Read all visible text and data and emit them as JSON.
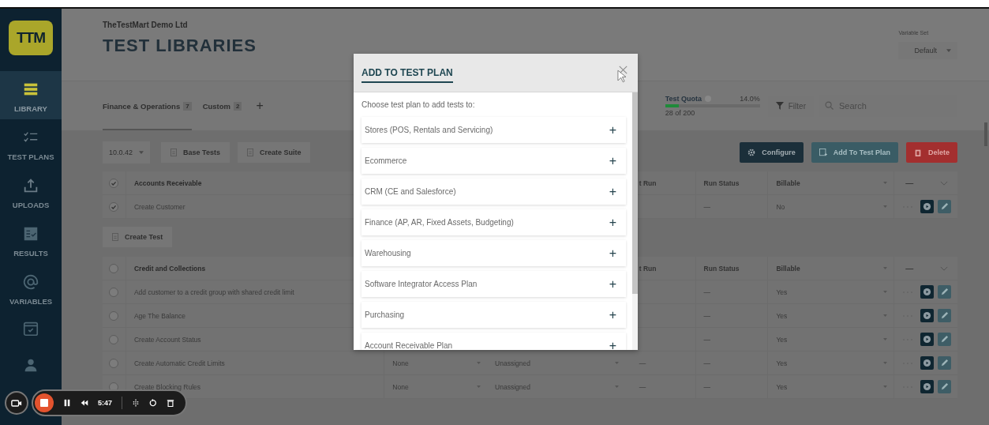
{
  "sidebar": {
    "logo": "TTM",
    "items": [
      {
        "label": "LIBRARY",
        "kind": "list",
        "selected": true
      },
      {
        "label": "TEST PLANS",
        "kind": "checklist",
        "selected": false
      },
      {
        "label": "UPLOADS",
        "kind": "upload",
        "selected": false
      },
      {
        "label": "RESULTS",
        "kind": "results",
        "selected": false
      },
      {
        "label": "VARIABLES",
        "kind": "at",
        "selected": false
      },
      {
        "kind": "calendar",
        "selected": false
      },
      {
        "kind": "person",
        "selected": false
      }
    ]
  },
  "header": {
    "company": "TheTestMart Demo Ltd",
    "title": "TEST LIBRARIES",
    "variable_set": {
      "label": "Variable Set",
      "value": "Default"
    }
  },
  "tabs": [
    {
      "label": "Finance & Operations",
      "count": "7",
      "selected": true
    },
    {
      "label": "Custom",
      "count": "2",
      "selected": false
    }
  ],
  "add_tab": "+",
  "quota": {
    "label": "Test Quota",
    "percent": "14.0%",
    "level": 0.14,
    "reading": "28 of 200"
  },
  "filter": "Filter",
  "search": {
    "placeholder": "Search"
  },
  "toolbar": {
    "version": "10.0.42",
    "left_buttons": [
      "Base Tests",
      "Create Suite"
    ],
    "right_buttons": [
      {
        "label": "Configure",
        "kind": "configure"
      },
      {
        "label": "Add To Test Plan",
        "kind": "add"
      },
      {
        "label": "Delete",
        "kind": "delete"
      }
    ]
  },
  "groups": [
    {
      "title": "Accounts Receivable",
      "checked": true,
      "headers": {
        "last_run": "t Run",
        "run_status": "Run Status",
        "billable": "Billable",
        "actions": "—"
      },
      "rows": [
        {
          "name": "Create Customer",
          "checked": true,
          "run_status": "—",
          "billable": "No"
        }
      ],
      "create_test": "Create Test"
    },
    {
      "title": "Credit and Collections",
      "checked": false,
      "headers": {
        "last_run": "t Run",
        "run_status": "Run Status",
        "billable": "Billable",
        "actions": "—"
      },
      "rows": [
        {
          "name": "Add customer to a credit group with shared credit limit",
          "checked": false,
          "run_status": "—",
          "billable": "Yes"
        },
        {
          "name": "Age The Balance",
          "checked": false,
          "run_status": "—",
          "billable": "Yes"
        },
        {
          "name": "Create Account Status",
          "checked": false,
          "run_status": "—",
          "billable": "Yes"
        },
        {
          "name": "Create Automatic Credit Limits",
          "checked": false,
          "column_3": "None",
          "column_4": "Unassigned",
          "last_run": "—",
          "run_status": "—",
          "billable": "Yes"
        },
        {
          "name": "Create Blocking Rules",
          "checked": false,
          "column_3": "None",
          "column_4": "Unassigned",
          "last_run": "—",
          "run_status": "—",
          "billable": "Yes"
        }
      ]
    }
  ],
  "dialog": {
    "title": "ADD TO TEST PLAN",
    "prompt": "Choose test plan to add tests to:",
    "plans": [
      "Stores (POS, Rentals and Servicing)",
      "Ecommerce",
      "CRM (CE and Salesforce)",
      "Finance (AP, AR, Fixed Assets, Budgeting)",
      "Warehousing",
      "Software Integrator Access Plan",
      "Purchasing",
      "Account Receivable Plan"
    ],
    "plan_action": "+"
  },
  "recorder": {
    "time": "5:47"
  }
}
